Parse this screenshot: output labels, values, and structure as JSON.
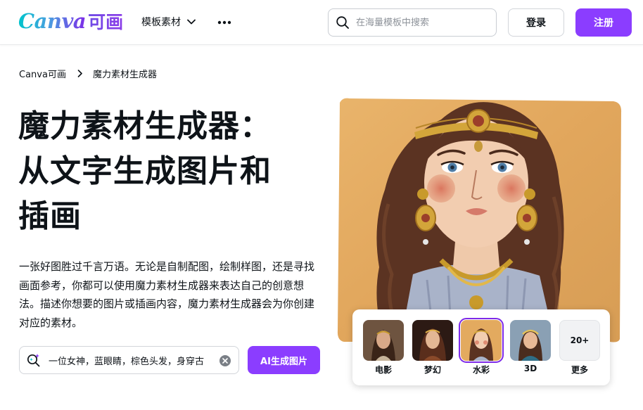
{
  "header": {
    "logo_text": "Canva",
    "logo_cn": "可画",
    "nav_item": "模板素材",
    "search_placeholder": "在海量模板中搜索",
    "login_label": "登录",
    "signup_label": "注册"
  },
  "breadcrumb": {
    "home": "Canva可画",
    "current": "魔力素材生成器"
  },
  "hero": {
    "title_line1": "魔力素材生成器：",
    "title_line2": "从文字生成图片和",
    "title_line3": "插画",
    "description": "一张好图胜过千言万语。无论是自制配图，绘制样图，还是寻找画面参考，你都可以使用魔力素材生成器来表达自己的创意想法。描述你想要的图片或插画内容，魔力素材生成器会为你创建对应的素材。"
  },
  "prompt": {
    "value": "一位女神，蓝眼睛，棕色头发，身穿古",
    "button_label": "AI生成图片"
  },
  "styles": {
    "items": [
      {
        "label": "电影",
        "icon": "portrait-thumbnail"
      },
      {
        "label": "梦幻",
        "icon": "portrait-thumbnail"
      },
      {
        "label": "水彩",
        "icon": "portrait-thumbnail"
      },
      {
        "label": "3D",
        "icon": "portrait-thumbnail"
      }
    ],
    "more_count": "20+",
    "more_label": "更多",
    "selected": "水彩"
  },
  "colors": {
    "accent": "#8b3dff",
    "text": "#0e1318",
    "art_background": "#e3aa5f"
  }
}
